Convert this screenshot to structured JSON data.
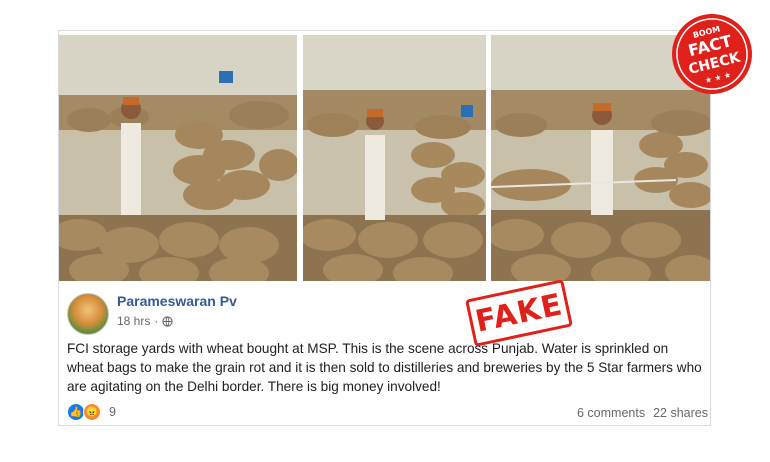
{
  "post": {
    "author": "Parameswaran Pv",
    "time": "18 hrs",
    "text": "FCI storage yards with wheat bought at MSP. This is the scene across Punjab. Water is sprinkled on wheat bags to make the grain rot and it is then sold to distilleries and breweries by the 5 Star farmers who are agitating on the Delhi border. There is big money involved!",
    "reaction_count": "9",
    "comments": "6 comments",
    "shares": "22 shares"
  },
  "stamp": {
    "label": "FAKE",
    "color": "#e0201b"
  },
  "badge": {
    "top": "BOOM",
    "line1": "FACT",
    "line2": "CHECK",
    "stars": "★ ★ ★",
    "color": "#e0201b"
  },
  "icons": [
    "globe-icon",
    "like-reaction-icon",
    "angry-reaction-icon"
  ]
}
